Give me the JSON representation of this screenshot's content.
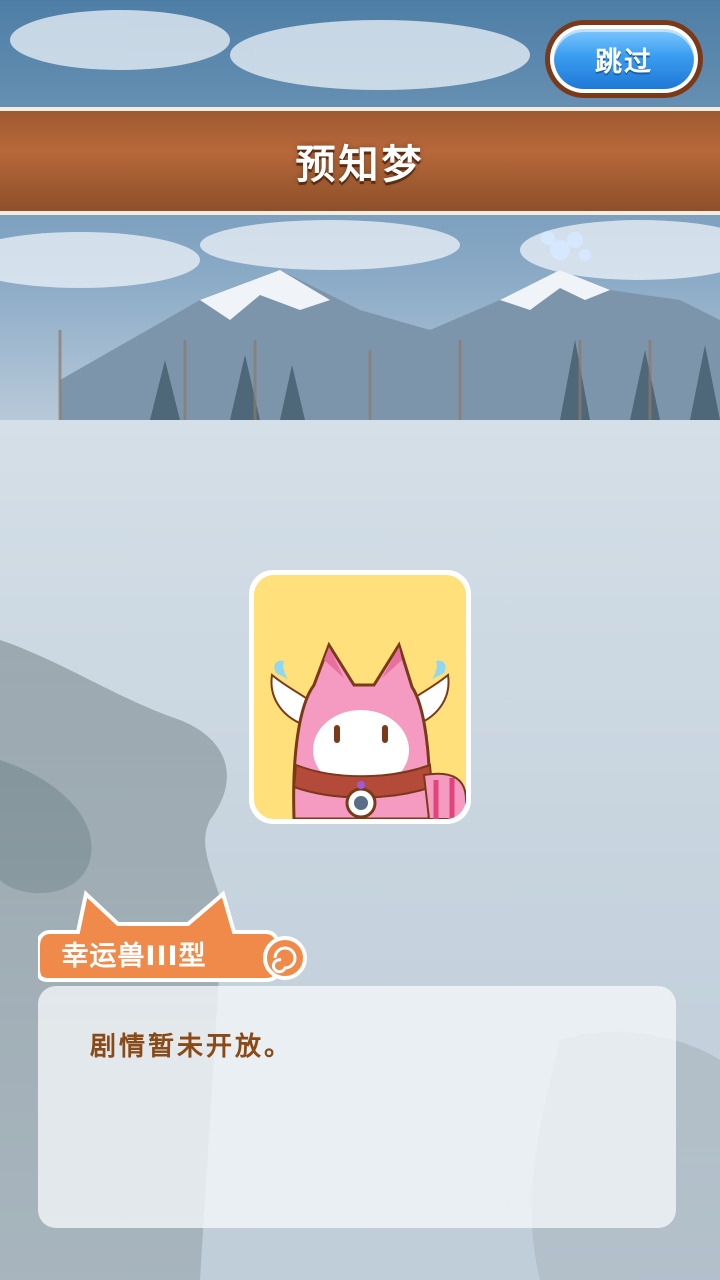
{
  "skip_button": {
    "label": "跳过"
  },
  "title_bar": {
    "title": "预知梦"
  },
  "speaker": {
    "name": "幸运兽III型"
  },
  "dialog": {
    "text": "剧情暂未开放。"
  },
  "colors": {
    "title_bar": "#a15c31",
    "skip_button": "#3a9df0",
    "name_tag": "#f08a4b",
    "dialog_text": "#8a4a18",
    "portrait_bg": "#ffe07a"
  },
  "icons": {
    "portrait": "lucky-beast-portrait",
    "name_tag_swirl": "swirl-tail-icon"
  }
}
